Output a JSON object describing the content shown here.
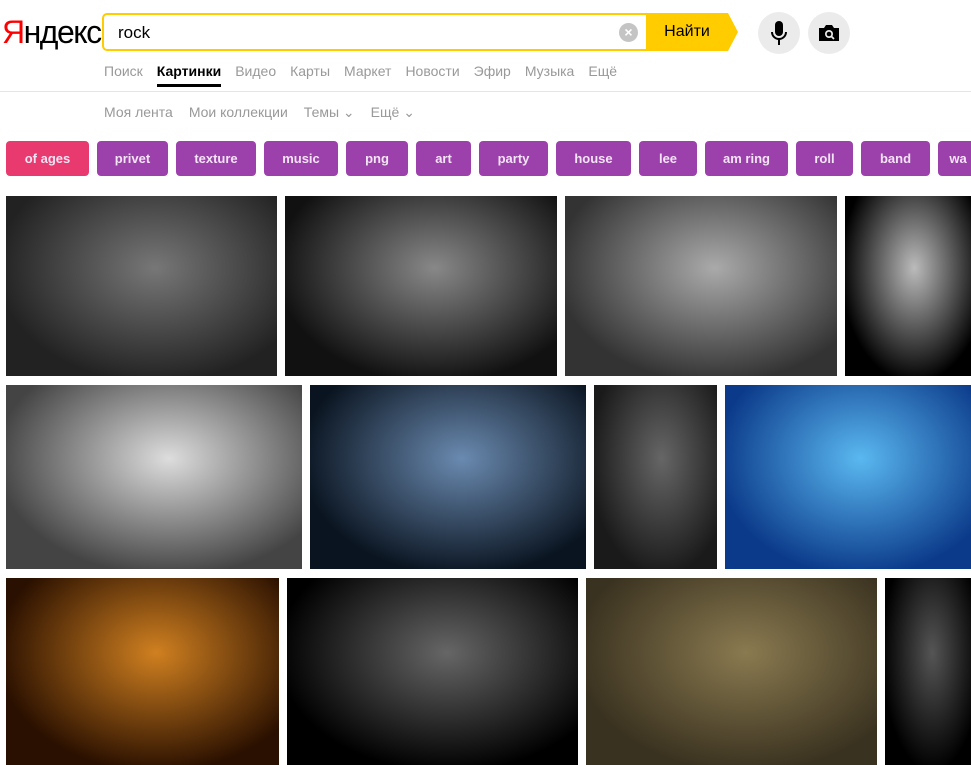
{
  "logo": {
    "first_letter": "Я",
    "rest": "ндекс"
  },
  "search": {
    "value": "rock",
    "button_label": "Найти",
    "clear_icon": "close-icon"
  },
  "icons": {
    "voice": "microphone-icon",
    "camera": "camera-search-icon"
  },
  "tabs": [
    {
      "label": "Поиск",
      "active": false
    },
    {
      "label": "Картинки",
      "active": true
    },
    {
      "label": "Видео",
      "active": false
    },
    {
      "label": "Карты",
      "active": false
    },
    {
      "label": "Маркет",
      "active": false
    },
    {
      "label": "Новости",
      "active": false
    },
    {
      "label": "Эфир",
      "active": false
    },
    {
      "label": "Музыка",
      "active": false
    },
    {
      "label": "Ещё",
      "active": false
    }
  ],
  "submenu": [
    {
      "label": "Моя лента"
    },
    {
      "label": "Мои коллекции"
    },
    {
      "label": "Темы ⌄"
    },
    {
      "label": "Ещё ⌄"
    }
  ],
  "chips": [
    "of ages",
    "privet",
    "texture",
    "music",
    "png",
    "art",
    "party",
    "house",
    "lee",
    "am ring",
    "roll",
    "band",
    "wa"
  ],
  "colors": {
    "accent": "#ffcc00",
    "chip": "#9c41ab",
    "chip_active": "#e83a6e",
    "logo_red": "#ff0000"
  },
  "image_count": 12
}
